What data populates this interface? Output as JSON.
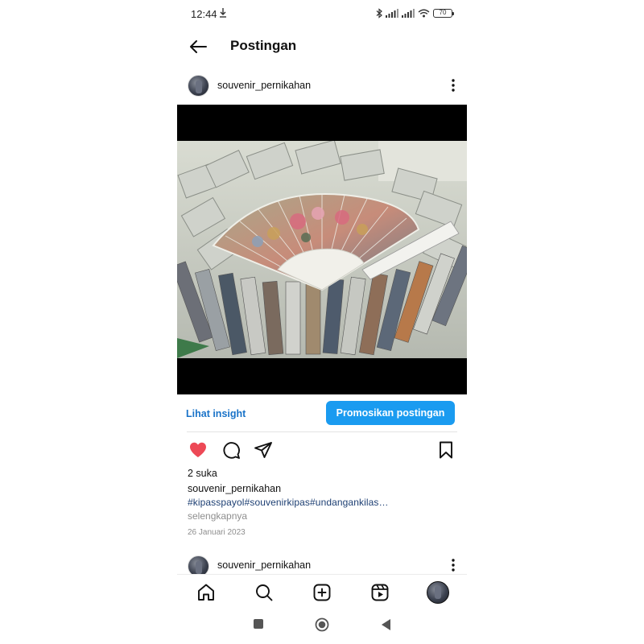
{
  "status_bar": {
    "time": "12:44",
    "battery": "70",
    "icons": [
      "download-icon",
      "bluetooth-icon",
      "signal-icon",
      "signal-icon",
      "wifi-icon",
      "battery-icon"
    ]
  },
  "header": {
    "title": "Postingan",
    "back_icon": "arrow-left-icon"
  },
  "post": {
    "username": "souvenir_pernikahan",
    "image_alt": "wedding-fan-souvenirs-photo",
    "insight_label": "Lihat insight",
    "promote_label": "Promosikan postingan",
    "liked": true,
    "likes_text": "2 suka",
    "caption_username": "souvenir_pernikahan",
    "hashtags": "#kipasspayol#souvenirkipas#undangankilas…",
    "more_label": "selengkapnya",
    "date": "26 Januari 2023",
    "action_icons": [
      "heart-filled-icon",
      "comment-icon",
      "share-icon",
      "bookmark-icon"
    ]
  },
  "next_post": {
    "username": "souvenir_pernikahan"
  },
  "bottom_nav": {
    "items": [
      "home-icon",
      "search-icon",
      "create-icon",
      "reels-icon",
      "profile-avatar"
    ]
  },
  "system_nav": {
    "items": [
      "recents-square-icon",
      "home-circle-icon",
      "back-triangle-icon"
    ]
  },
  "colors": {
    "accent_blue": "#1a9bf0",
    "link_blue": "#1a73c8",
    "hashtag_blue": "#1d3f73",
    "like_red": "#ed4956",
    "muted_gray": "#8e8e8e"
  }
}
